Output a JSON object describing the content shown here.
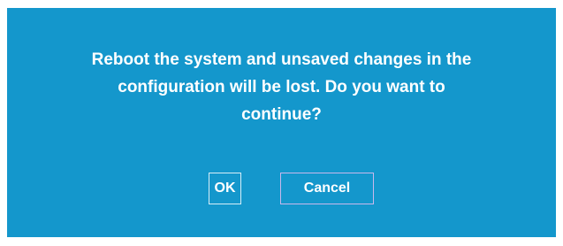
{
  "dialog": {
    "message_lines": [
      "Reboot the system and unsaved changes in the",
      "configuration will be lost. Do you want to",
      "continue?"
    ],
    "ok_label": "OK",
    "cancel_label": "Cancel"
  },
  "colors": {
    "dialog_background": "#1497cc",
    "text": "#ffffff",
    "page_background": "#ffffff"
  }
}
